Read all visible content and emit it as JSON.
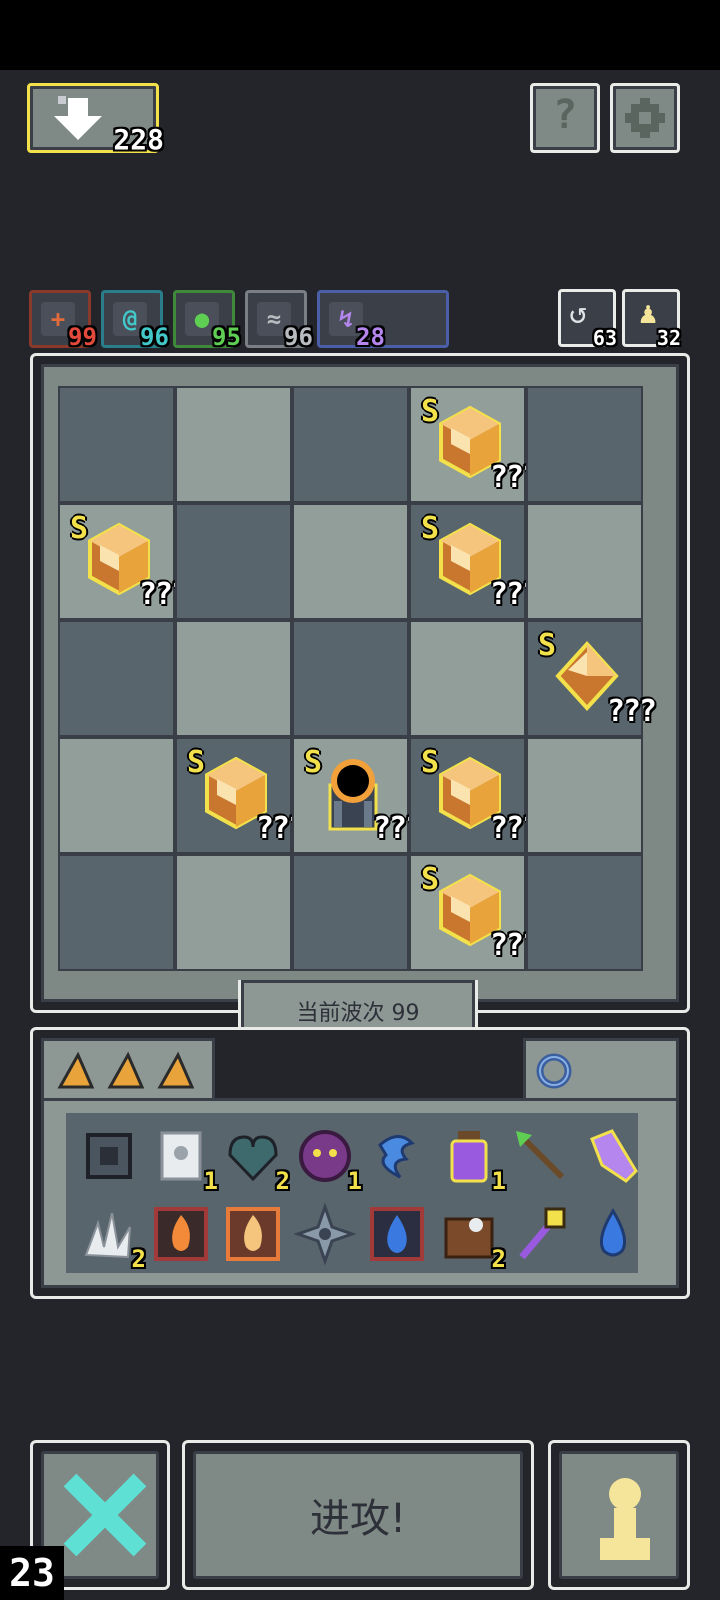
{
  "top": {
    "flag_count": "228"
  },
  "stats": [
    {
      "name": "attack",
      "value": "99",
      "color": "#e34a3b",
      "border": "#8a3a2a"
    },
    {
      "name": "spiral",
      "value": "96",
      "color": "#42c8c8",
      "border": "#2a7d8a"
    },
    {
      "name": "nature",
      "value": "95",
      "color": "#5fcf54",
      "border": "#3e8a3a"
    },
    {
      "name": "wind",
      "value": "96",
      "color": "#b8bcc0",
      "border": "#7a7f86"
    },
    {
      "name": "lightning",
      "value": "28",
      "color": "#b486ee",
      "border": "#4b5ea8"
    }
  ],
  "side_counters": {
    "refresh": "63",
    "pawn": "32"
  },
  "board": {
    "cells": [
      {
        "row": 0,
        "col": 3,
        "rank": "S",
        "label": "???",
        "type": "cube"
      },
      {
        "row": 1,
        "col": 0,
        "rank": "S",
        "label": "???",
        "type": "cube"
      },
      {
        "row": 1,
        "col": 3,
        "rank": "S",
        "label": "???",
        "type": "cube"
      },
      {
        "row": 2,
        "col": 4,
        "rank": "S",
        "label": "???",
        "type": "diamond"
      },
      {
        "row": 3,
        "col": 1,
        "rank": "S",
        "label": "???",
        "type": "cube"
      },
      {
        "row": 3,
        "col": 2,
        "rank": "S",
        "label": "???",
        "type": "portal"
      },
      {
        "row": 3,
        "col": 3,
        "rank": "S",
        "label": "???",
        "type": "cube"
      },
      {
        "row": 4,
        "col": 3,
        "rank": "S",
        "label": "???",
        "type": "cube"
      }
    ]
  },
  "wave_label": "当前波次 99",
  "inventory": {
    "items": [
      {
        "icon": "chip-icon",
        "count": ""
      },
      {
        "icon": "scroll-icon",
        "count": "1"
      },
      {
        "icon": "heart-gem-icon",
        "count": "2"
      },
      {
        "icon": "demon-mask-icon",
        "count": "1"
      },
      {
        "icon": "water-spirit-icon",
        "count": ""
      },
      {
        "icon": "potion-icon",
        "count": "1"
      },
      {
        "icon": "arrow-icon",
        "count": ""
      },
      {
        "icon": "crystal-icon",
        "count": ""
      },
      {
        "icon": "claw-icon",
        "count": "2"
      },
      {
        "icon": "fire-card-icon",
        "count": ""
      },
      {
        "icon": "flame-card-icon",
        "count": ""
      },
      {
        "icon": "shuriken-icon",
        "count": ""
      },
      {
        "icon": "water-card-icon",
        "count": ""
      },
      {
        "icon": "bear-icon",
        "count": "2"
      },
      {
        "icon": "staff-icon",
        "count": ""
      },
      {
        "icon": "water-drop-icon",
        "count": ""
      }
    ]
  },
  "attack_button": "进攻!",
  "corner_counter": "23",
  "colors": {
    "gold": "#f2e14b",
    "cyan": "#5fe0d4",
    "pawn": "#f5e59a"
  }
}
